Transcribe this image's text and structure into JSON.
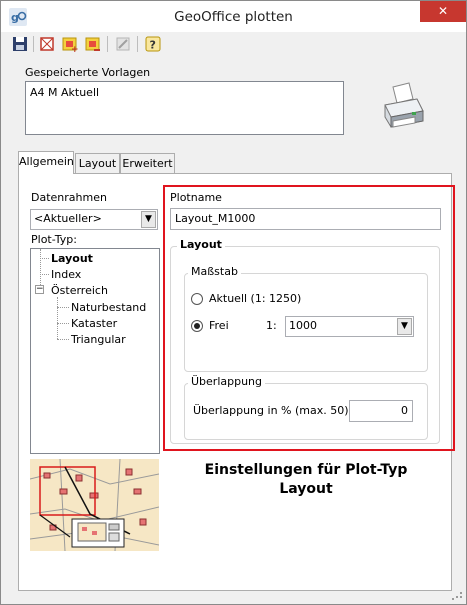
{
  "window": {
    "title": "GeoOffice plotten",
    "close_glyph": "✕"
  },
  "toolbar": {
    "buttons": [
      {
        "name": "save-icon"
      },
      {
        "name": "frame-icon"
      },
      {
        "name": "layout-add-icon"
      },
      {
        "name": "layout-remove-icon"
      },
      {
        "name": "disabled-tool-icon"
      },
      {
        "name": "help-icon"
      }
    ]
  },
  "templates": {
    "label": "Gespeicherte Vorlagen",
    "items": [
      "A4 M Aktuell"
    ]
  },
  "tabs": [
    "Allgemein",
    "Layout",
    "Erweitert"
  ],
  "left": {
    "datenrahmen_label": "Datenrahmen",
    "datenrahmen_value": "<Aktueller>",
    "plottyp_label": "Plot-Typ:",
    "tree": {
      "layout": "Layout",
      "index": "Index",
      "oesterreich": "Österreich",
      "expander": "−",
      "naturbestand": "Naturbestand",
      "kataster": "Kataster",
      "triangular": "Triangular"
    }
  },
  "right": {
    "plotname_label": "Plotname",
    "plotname_value": "Layout_M1000",
    "layout_group": "Layout",
    "massstab_group": "Maßstab",
    "aktuell_label": "Aktuell (1: 1250)",
    "frei_label": "Frei",
    "scale_prefix": "1:",
    "scale_value": "1000",
    "selected_scale": "frei",
    "ueberlappung_group": "Überlappung",
    "ueberlappung_label": "Überlappung in % (max. 50)",
    "ueberlappung_value": "0"
  },
  "caption": {
    "line1": "Einstellungen für Plot-Typ",
    "line2": "Layout"
  },
  "colors": {
    "highlight": "#e0141e",
    "close": "#c7372f"
  }
}
